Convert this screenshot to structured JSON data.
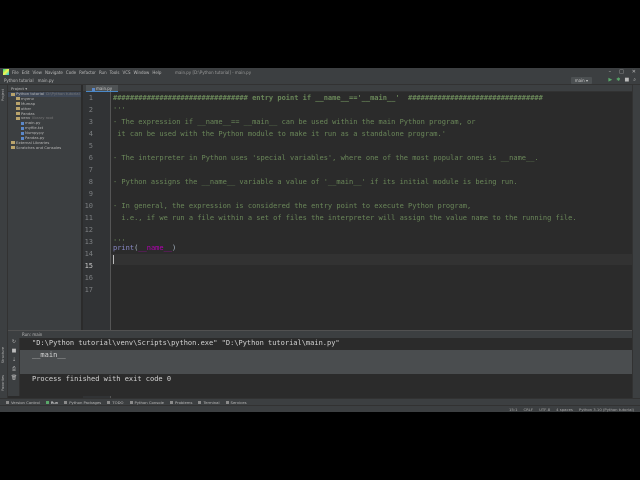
{
  "window": {
    "title": "main.py [D:\\Python tutorial] - main.py",
    "menu": [
      "File",
      "Edit",
      "View",
      "Navigate",
      "Code",
      "Refactor",
      "Run",
      "Tools",
      "VCS",
      "Window",
      "Help"
    ]
  },
  "navbar": {
    "project": "Python tutorial",
    "file": "main.py",
    "run_config": "main"
  },
  "left_strip": {
    "project_label": "Project",
    "structure_label": "Structure",
    "favorites_label": "Favorites"
  },
  "project_panel": {
    "header": "Project",
    "items": [
      {
        "label": "Python tutorial",
        "detail": "D:\\Python tutorial",
        "kind": "folder",
        "indent": 0
      },
      {
        "label": "myenv",
        "kind": "folder",
        "indent": 1
      },
      {
        "label": "Mumap",
        "kind": "folder",
        "indent": 1
      },
      {
        "label": "other",
        "kind": "folder",
        "indent": 1
      },
      {
        "label": "Pandas",
        "kind": "folder",
        "indent": 1
      },
      {
        "label": "venv",
        "detail": "library root",
        "kind": "folder",
        "indent": 1
      },
      {
        "label": "main.py",
        "kind": "py",
        "indent": 2
      },
      {
        "label": "myfile.txt",
        "kind": "py",
        "indent": 2
      },
      {
        "label": "Numpy.py",
        "kind": "py",
        "indent": 2
      },
      {
        "label": "Pandas.py",
        "kind": "py",
        "indent": 2
      },
      {
        "label": "External Libraries",
        "kind": "folder",
        "indent": 0
      },
      {
        "label": "Scratches and Consoles",
        "kind": "folder",
        "indent": 0
      }
    ]
  },
  "editor": {
    "tab": "main.py",
    "line_numbers": [
      "1",
      "2",
      "3",
      "4",
      "5",
      "6",
      "7",
      "8",
      "9",
      "10",
      "11",
      "12",
      "13",
      "14",
      "15",
      "16",
      "17"
    ],
    "current_line": 15,
    "lines": [
      "################################ entry point if __name__=='__main__'  ################################",
      "'''",
      "- The expression if __name__== __main__ can be used within the main Python program, or",
      " it can be used with the Python module to make it run as a standalone program.'",
      "",
      "- The interpreter in Python uses 'special variables', where one of the most popular ones is __name__.",
      "",
      "- Python assigns the __name__ variable a value of '__main__' if its initial module is being run.",
      "",
      "- In general, the expression is considered the entry point to execute Python program,",
      "  i.e., if we run a file within a set of files the interpreter will assign the value name to the running file.",
      "",
      "'''",
      "",
      "",
      "",
      ""
    ],
    "print_line": {
      "fn": "print",
      "open": "(",
      "arg": "__name__",
      "close": ")"
    }
  },
  "run_panel": {
    "tab_label": "Run:",
    "config": "main",
    "output": [
      "\"D:\\Python tutorial\\venv\\Scripts\\python.exe\" \"D:\\Python tutorial\\main.py\"",
      "__main__",
      "",
      "Process finished with exit code 0"
    ]
  },
  "bottom_toolbar": [
    "Version Control",
    "Run",
    "Python Packages",
    "TODO",
    "Python Console",
    "Problems",
    "Terminal",
    "Services"
  ],
  "status_bar": [
    "15:1",
    "CRLF",
    "UTF-8",
    "4 spaces",
    "Python 3.10 (Python tutorial)"
  ]
}
